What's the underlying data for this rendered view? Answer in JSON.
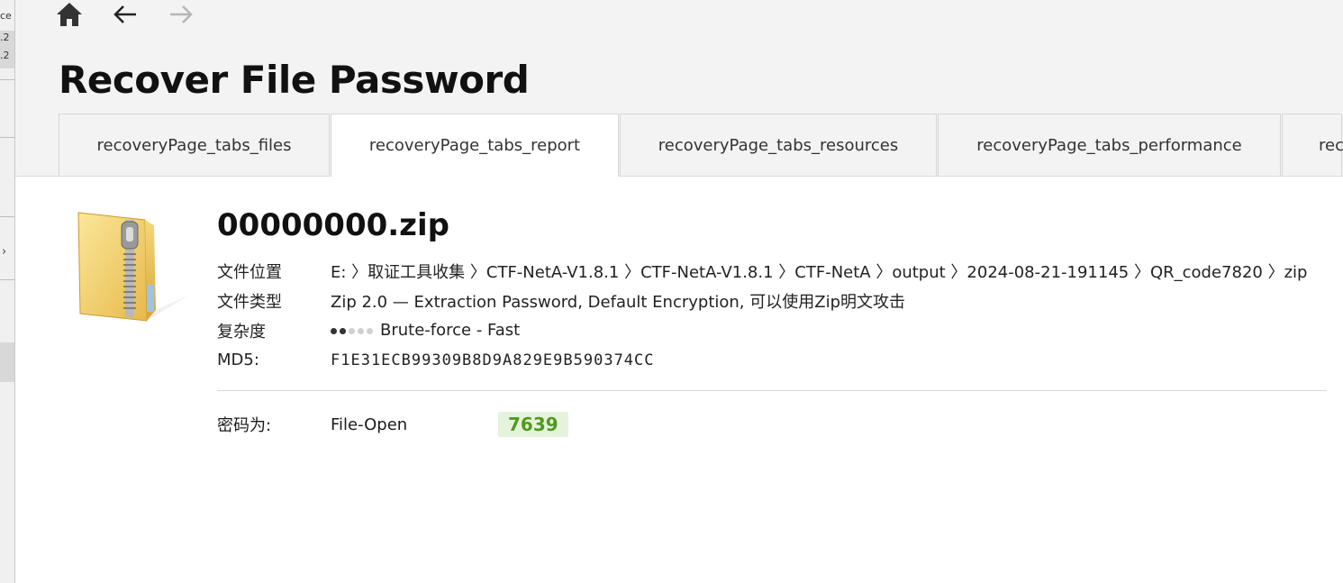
{
  "window": {
    "title": "Recover File Password"
  },
  "side_fragment": {
    "lines": [
      "ce",
      ".2",
      ".2"
    ]
  },
  "nav": {
    "home_icon": "home-icon",
    "back_icon": "arrow-left-icon",
    "forward_icon": "arrow-right-icon"
  },
  "tabs": [
    {
      "label": "recoveryPage_tabs_files"
    },
    {
      "label": "recoveryPage_tabs_report"
    },
    {
      "label": "recoveryPage_tabs_resources"
    },
    {
      "label": "recoveryPage_tabs_performance"
    },
    {
      "label": "rec"
    }
  ],
  "active_tab": "recoveryPage_tabs_report",
  "file": {
    "name": "00000000.zip",
    "icon": "zip-folder-icon",
    "location_label": "文件位置",
    "location_value": "E: 〉取证工具收集 〉CTF-NetA-V1.8.1 〉CTF-NetA-V1.8.1 〉CTF-NetA 〉output 〉2024-08-21-191145 〉QR_code7820 〉zip",
    "type_label": "文件类型",
    "type_value": "Zip 2.0 — Extraction Password, Default Encryption, 可以使用Zip明文攻击",
    "complexity_label": "复杂度",
    "complexity_value": "Brute-force - Fast",
    "complexity_level": 2,
    "complexity_max": 5,
    "md5_label": "MD5:",
    "md5_value": "F1E31ECB99309B8D9A829E9B590374CC"
  },
  "password": {
    "label": "密码为:",
    "kind": "File-Open",
    "value": "7639"
  },
  "colors": {
    "password_badge_bg": "#e6f3dc",
    "password_badge_text": "#4f9a1f"
  }
}
